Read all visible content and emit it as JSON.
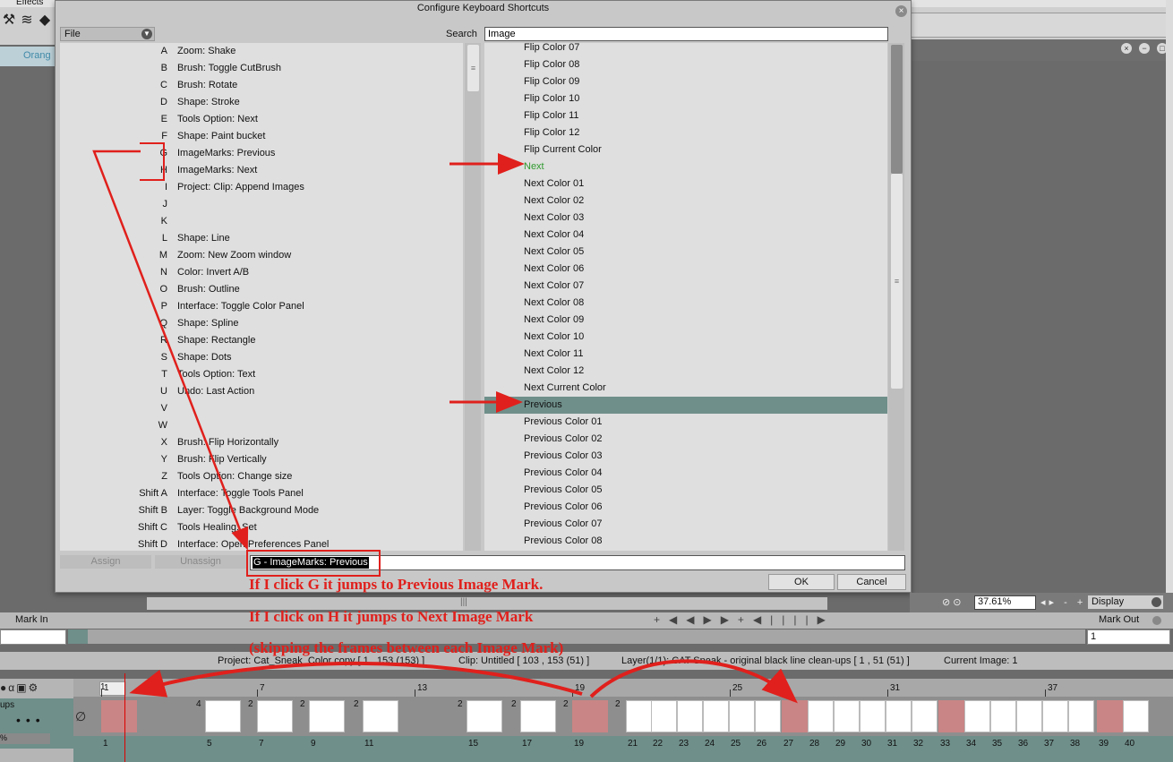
{
  "app": {
    "menu": [
      "Effects"
    ],
    "orange_tab": "Orang"
  },
  "dialog": {
    "title": "Configure Keyboard Shortcuts",
    "category_selected": "File",
    "search_label": "Search",
    "search_value": "Image",
    "key_rows": [
      {
        "key": "A",
        "action": "Zoom: Shake"
      },
      {
        "key": "B",
        "action": "Brush: Toggle CutBrush"
      },
      {
        "key": "C",
        "action": "Brush: Rotate"
      },
      {
        "key": "D",
        "action": "Shape: Stroke"
      },
      {
        "key": "E",
        "action": "Tools Option: Next"
      },
      {
        "key": "F",
        "action": "Shape: Paint bucket"
      },
      {
        "key": "G",
        "action": "ImageMarks: Previous"
      },
      {
        "key": "H",
        "action": "ImageMarks: Next"
      },
      {
        "key": "I",
        "action": "Project: Clip: Append Images"
      },
      {
        "key": "J",
        "action": ""
      },
      {
        "key": "K",
        "action": ""
      },
      {
        "key": "L",
        "action": "Shape: Line"
      },
      {
        "key": "M",
        "action": "Zoom: New Zoom window"
      },
      {
        "key": "N",
        "action": "Color: Invert A/B"
      },
      {
        "key": "O",
        "action": "Brush: Outline"
      },
      {
        "key": "P",
        "action": "Interface: Toggle Color Panel"
      },
      {
        "key": "Q",
        "action": "Shape: Spline"
      },
      {
        "key": "R",
        "action": "Shape: Rectangle"
      },
      {
        "key": "S",
        "action": "Shape: Dots"
      },
      {
        "key": "T",
        "action": "Tools Option: Text"
      },
      {
        "key": "U",
        "action": "Undo: Last Action"
      },
      {
        "key": "V",
        "action": ""
      },
      {
        "key": "W",
        "action": ""
      },
      {
        "key": "X",
        "action": "Brush: Flip Horizontally"
      },
      {
        "key": "Y",
        "action": "Brush: Flip Vertically"
      },
      {
        "key": "Z",
        "action": "Tools Option: Change size"
      },
      {
        "key": "Shift A",
        "action": "Interface: Toggle Tools Panel"
      },
      {
        "key": "Shift B",
        "action": "Layer: Toggle Background Mode"
      },
      {
        "key": "Shift C",
        "action": "Tools Healing: Set"
      },
      {
        "key": "Shift D",
        "action": "Interface: Open Preferences Panel"
      }
    ],
    "action_rows": [
      "Flip Color 07",
      "Flip Color 08",
      "Flip Color 09",
      "Flip Color 10",
      "Flip Color 11",
      "Flip Color 12",
      "Flip Current Color",
      "Next",
      "Next Color 01",
      "Next Color 02",
      "Next Color 03",
      "Next Color 04",
      "Next Color 05",
      "Next Color 06",
      "Next Color 07",
      "Next Color 08",
      "Next Color 09",
      "Next Color 10",
      "Next Color 11",
      "Next Color 12",
      "Next Current Color",
      "Previous",
      "Previous Color 01",
      "Previous Color 02",
      "Previous Color 03",
      "Previous Color 04",
      "Previous Color 05",
      "Previous Color 06",
      "Previous Color 07",
      "Previous Color 08"
    ],
    "highlighted_action": "Next",
    "selected_action": "Previous",
    "assign_label": "Assign",
    "unassign_label": "Unassign",
    "shortcut_value": "G - ImageMarks: Previous",
    "ok_label": "OK",
    "cancel_label": "Cancel"
  },
  "viewer": {
    "zoom_value": "37.61%",
    "zoom_controls": "- +",
    "display_label": "Display",
    "mark_in_label": "Mark In",
    "mark_out_label": "Mark Out",
    "mark_out_value": "1"
  },
  "info_bar": {
    "project": "Project: Cat_Sneak_Color copy [ 1 , 153  (153) ]",
    "clip": "Clip: Untitled [ 103 , 153  (51) ]",
    "layer": "Layer(1/1): CAT Sneak - original black line clean-ups [ 1 , 51  (51) ]",
    "current_image": "Current Image: 1"
  },
  "timeline": {
    "layer_label": "ups",
    "percent_label": "%",
    "current_frame": "1",
    "top_numbers": [
      "1",
      "7",
      "13",
      "19",
      "25",
      "31",
      "37"
    ],
    "frame_numbers": [
      "1",
      "5",
      "7",
      "9",
      "11",
      "15",
      "17",
      "19",
      "21",
      "22",
      "23",
      "24",
      "25",
      "26",
      "27",
      "28",
      "29",
      "30",
      "31",
      "32",
      "33",
      "34",
      "35",
      "36",
      "37",
      "38",
      "39",
      "40"
    ],
    "hold_labels": [
      "4",
      "2",
      "2",
      "2",
      "2",
      "2",
      "2",
      "2"
    ],
    "image_mark_frames": [
      "1",
      "19",
      "27",
      "33",
      "39"
    ]
  },
  "annotations": {
    "line1": "If I click G it jumps to Previous Image Mark.",
    "line2": "If I click on H it jumps to Next Image Mark",
    "line3": "(skipping the frames between each Image Mark)",
    "color": "#e0201c"
  },
  "colors": {
    "selection": "#6f8f8a",
    "highlight_text": "#2f9a2f",
    "image_mark": "#c98585"
  }
}
